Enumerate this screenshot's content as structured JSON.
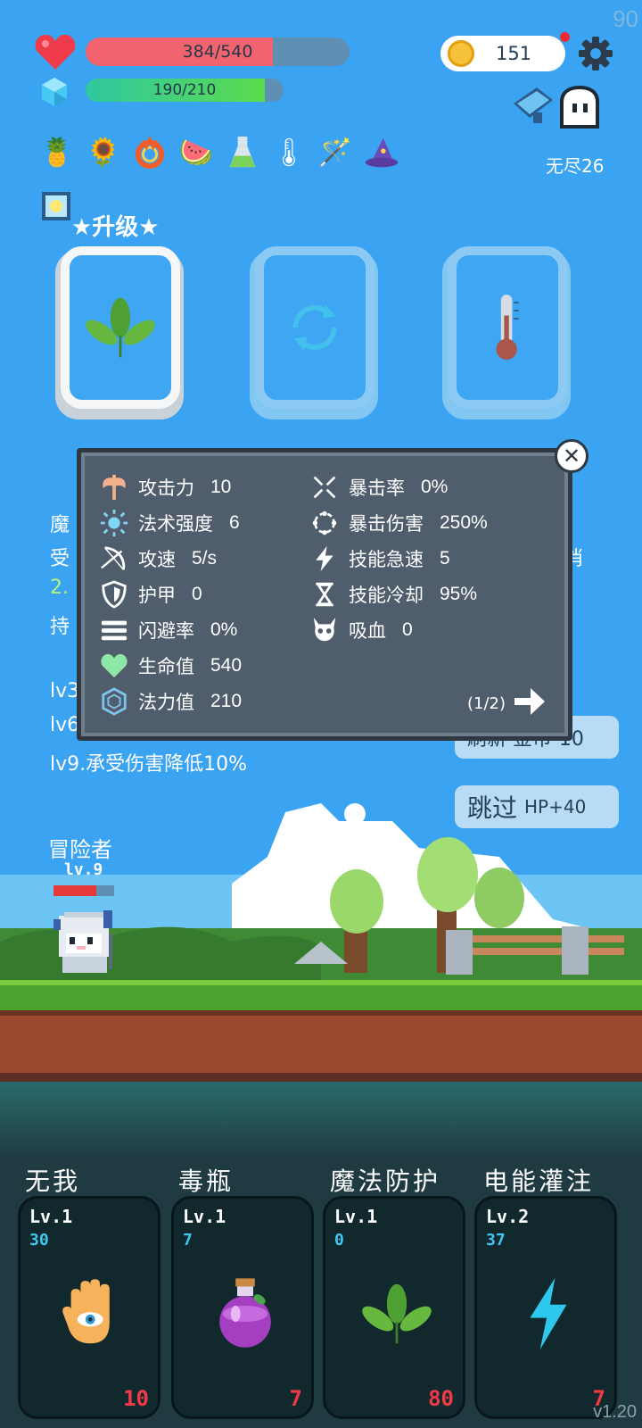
{
  "hud": {
    "fps": "90",
    "hp_text": "384/540",
    "hp_fraction": 0.711,
    "mp_text": "190/210",
    "mp_fraction": 0.905,
    "coins": "151",
    "mode_label": "无尽26"
  },
  "items": [
    "pineapple-icon",
    "sunflower-icon",
    "fire-ring-icon",
    "watermelon-icon",
    "flask-icon",
    "thermometer-icon",
    "magic-wand-icon",
    "wizard-hat-icon"
  ],
  "upgrade": {
    "title": "★升级★"
  },
  "stats": {
    "left": [
      {
        "label": "攻击力",
        "value": "10",
        "icon": "axe-icon"
      },
      {
        "label": "法术强度",
        "value": "6",
        "icon": "sun-icon"
      },
      {
        "label": "攻速",
        "value": "5/s",
        "icon": "bow-icon"
      },
      {
        "label": "护甲",
        "value": "0",
        "icon": "shield-icon"
      },
      {
        "label": "闪避率",
        "value": "0%",
        "icon": "lines-icon"
      },
      {
        "label": "生命值",
        "value": "540",
        "icon": "heart-icon"
      },
      {
        "label": "法力值",
        "value": "210",
        "icon": "crystal-icon"
      }
    ],
    "right": [
      {
        "label": "暴击率",
        "value": "0%",
        "icon": "crossed-swords-icon"
      },
      {
        "label": "暴击伤害",
        "value": "250%",
        "icon": "burst-ring-icon"
      },
      {
        "label": "技能急速",
        "value": "5",
        "icon": "lightning-icon"
      },
      {
        "label": "技能冷却",
        "value": "95%",
        "icon": "hourglass-icon"
      },
      {
        "label": "吸血",
        "value": "0",
        "icon": "skull-icon"
      }
    ],
    "pager": "(1/2)"
  },
  "behind": {
    "line1": "魔",
    "line2": "受",
    "line3": "2.",
    "line4": "持",
    "line5": "lv3",
    "line6": "lv6",
    "line7": "lv9.承受伤害降低10%",
    "right_frag": "消",
    "refresh_frag": "刷新 金币-10",
    "skip_label": "跳过",
    "skip_bonus": "HP+40"
  },
  "hero": {
    "name": "冒险者",
    "level": "lv.9"
  },
  "skills": [
    {
      "name": "无我",
      "level": "Lv.1",
      "count": "30",
      "cost": "10",
      "icon": "eye-hand-icon"
    },
    {
      "name": "毒瓶",
      "level": "Lv.1",
      "count": "7",
      "cost": "7",
      "icon": "poison-bottle-icon"
    },
    {
      "name": "魔法防护",
      "level": "Lv.1",
      "count": "0",
      "cost": "80",
      "icon": "leaf-icon"
    },
    {
      "name": "电能灌注",
      "level": "Lv.2",
      "count": "37",
      "cost": "7",
      "icon": "lightning-icon"
    }
  ],
  "version": "v1.20"
}
